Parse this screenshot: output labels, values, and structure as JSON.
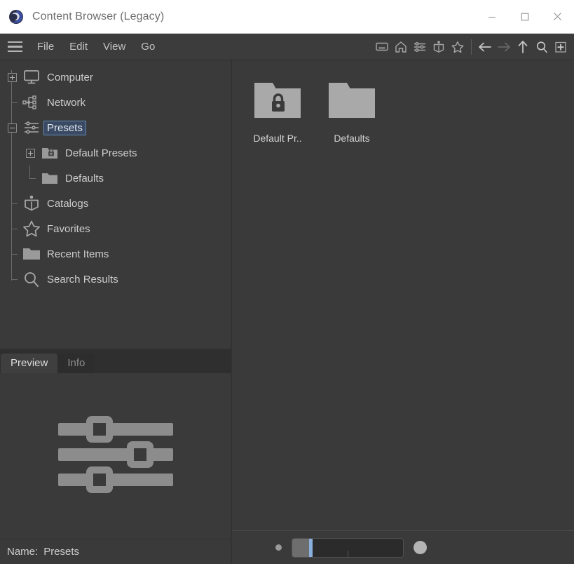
{
  "window": {
    "title": "Content Browser (Legacy)",
    "logo_icon": "cinema4d-logo-icon",
    "controls": [
      {
        "name": "minimize-button",
        "icon": "minimize-icon"
      },
      {
        "name": "maximize-button",
        "icon": "maximize-icon"
      },
      {
        "name": "close-button",
        "icon": "close-icon"
      }
    ]
  },
  "menubar": {
    "hamburger_icon": "hamburger-menu-icon",
    "items": [
      {
        "label": "File"
      },
      {
        "label": "Edit"
      },
      {
        "label": "View"
      },
      {
        "label": "Go"
      }
    ]
  },
  "toolbar": {
    "buttons": [
      {
        "name": "computer-button",
        "icon": "computer-icon",
        "enabled": true
      },
      {
        "name": "home-button",
        "icon": "home-icon",
        "enabled": true
      },
      {
        "name": "presets-button",
        "icon": "sliders-icon",
        "enabled": true
      },
      {
        "name": "catalogs-button",
        "icon": "catalog-book-icon",
        "enabled": true
      },
      {
        "name": "favorites-button",
        "icon": "star-icon",
        "enabled": true
      },
      {
        "name": "back-button",
        "icon": "arrow-left-icon",
        "enabled": true
      },
      {
        "name": "forward-button",
        "icon": "arrow-right-icon",
        "enabled": false
      },
      {
        "name": "up-button",
        "icon": "arrow-up-icon",
        "enabled": true
      },
      {
        "name": "search-button",
        "icon": "search-icon",
        "enabled": true
      },
      {
        "name": "new-panel-button",
        "icon": "add-box-icon",
        "enabled": true
      }
    ]
  },
  "tree": {
    "items": [
      {
        "label": "Computer",
        "icon": "monitor-icon",
        "toggle": "plus",
        "depth": 0,
        "selected": false
      },
      {
        "label": "Network",
        "icon": "network-icon",
        "toggle": "none",
        "depth": 0,
        "selected": false
      },
      {
        "label": "Presets",
        "icon": "sliders-icon",
        "toggle": "minus",
        "depth": 0,
        "selected": true
      },
      {
        "label": "Default Presets",
        "icon": "folder-locked-icon",
        "toggle": "plus",
        "depth": 1,
        "selected": false
      },
      {
        "label": "Defaults",
        "icon": "folder-icon",
        "toggle": "none",
        "depth": 1,
        "selected": false
      },
      {
        "label": "Catalogs",
        "icon": "catalog-book-icon",
        "toggle": "none",
        "depth": 0,
        "selected": false
      },
      {
        "label": "Favorites",
        "icon": "star-icon",
        "toggle": "none",
        "depth": 0,
        "selected": false
      },
      {
        "label": "Recent Items",
        "icon": "folder-icon",
        "toggle": "none",
        "depth": 0,
        "selected": false
      },
      {
        "label": "Search Results",
        "icon": "search-icon",
        "toggle": "none",
        "depth": 0,
        "selected": false
      }
    ]
  },
  "preview": {
    "tabs": [
      {
        "label": "Preview",
        "active": true
      },
      {
        "label": "Info",
        "active": false
      }
    ],
    "thumbnail_icon": "sliders-large-icon",
    "name_label": "Name:",
    "name_value": "Presets"
  },
  "content": {
    "items": [
      {
        "label": "Default Pr..",
        "icon": "folder-locked-icon"
      },
      {
        "label": "Defaults",
        "icon": "folder-icon"
      }
    ]
  },
  "statusbar": {
    "small_dot_icon": "small-thumbnail-size-icon",
    "large_dot_icon": "large-thumbnail-size-icon",
    "zoom_slider_name": "thumbnail-size-slider"
  },
  "colors": {
    "titlebar_bg": "#ffffff",
    "chrome_bg": "#3c3c3c",
    "panel_bg": "#3a3a3a",
    "selection_fill": "#3b4a63",
    "selection_border": "#6389b8",
    "accent_blue": "#8ab0dd",
    "icon_gray": "#a8a8a8",
    "text_gray": "#cdcdcd"
  }
}
